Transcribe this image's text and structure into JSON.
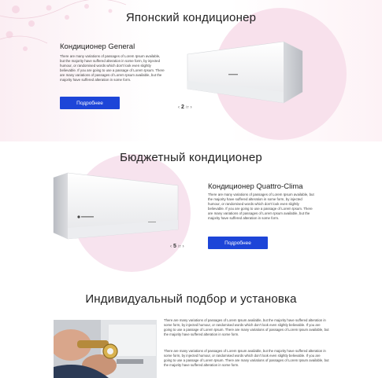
{
  "sections": [
    {
      "title": "Японский кондиционер",
      "product": {
        "name": "Кондиционер General",
        "description": "There are many variations of passages of Lorem Ipsum available, but the majority have suffered alteration in some form, by injected humour, or randomised words which don't look even slightly believable. If you are going to use a passage of Lorem Ipsum. There are many variations of passages of Lorem Ipsum available, but the majority have suffered alteration in some form.",
        "button": "Подробнее",
        "pager": {
          "prev": "‹",
          "current": "2",
          "total": "/7",
          "next": "›"
        }
      }
    },
    {
      "title": "Бюджетный кондиционер",
      "product": {
        "name": "Кондиционер Quattro-Clima",
        "description": "There are many variations of passages of Lorem Ipsum available, but the majority have suffered alteration in some form, by injected humour, or randomised words which don't look even slightly believable. If you are going to use a passage of Lorem Ipsum. There are many variations of passages of Lorem Ipsum available, but the majority have suffered alteration in some form.",
        "button": "Подробнее",
        "pager": {
          "prev": "‹",
          "current": "5",
          "total": "/7",
          "next": "›"
        }
      }
    }
  ],
  "install": {
    "title": "Индивидуальный подбор и установка",
    "paragraph1": "There are many variations of passages of Lorem Ipsum available, but the majority have suffered alteration in some form, by injected humour, or randomised words which don't look even slightly believable. If you are going to use a passage of Lorem Ipsum. There are many variations of passages of Lorem Ipsum available, but the majority have suffered alteration in some form.",
    "paragraph2": "There are many variations of passages of Lorem Ipsum available, but the majority have suffered alteration in some form, by injected humour, or randomised words which don't look even slightly believable. If you are going to use a passage of Lorem Ipsum. There are many variations of passages of Lorem Ipsum available, but the majority have suffered alteration in some form."
  },
  "colors": {
    "accent": "#1d45d8",
    "pink": "#f8e1ec"
  }
}
